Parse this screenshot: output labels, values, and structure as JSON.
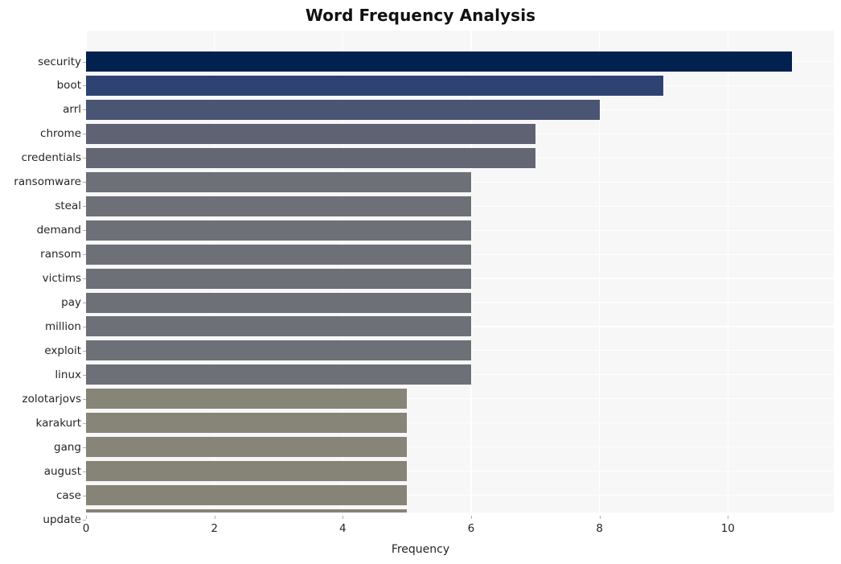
{
  "chart_data": {
    "type": "bar",
    "orientation": "horizontal",
    "title": "Word Frequency Analysis",
    "xlabel": "Frequency",
    "ylabel": "",
    "categories": [
      "security",
      "boot",
      "arrl",
      "chrome",
      "credentials",
      "ransomware",
      "steal",
      "demand",
      "ransom",
      "victims",
      "pay",
      "million",
      "exploit",
      "linux",
      "zolotarjovs",
      "karakurt",
      "gang",
      "august",
      "case",
      "update"
    ],
    "values": [
      11,
      9,
      8,
      7,
      7,
      6,
      6,
      6,
      6,
      6,
      6,
      6,
      6,
      6,
      5,
      5,
      5,
      5,
      5,
      5
    ],
    "bar_colors": [
      "#03214f",
      "#2e4371",
      "#4a5574",
      "#5e6272",
      "#646773",
      "#6e7077",
      "#6e7077",
      "#6e7077",
      "#6e7077",
      "#6e7077",
      "#6e7077",
      "#6e7077",
      "#6e7077",
      "#6e7077",
      "#878578",
      "#878578",
      "#878578",
      "#868477",
      "#868477",
      "#868477"
    ],
    "xlim": [
      0,
      11.65
    ],
    "xticks": [
      0,
      2,
      4,
      6,
      8,
      10
    ],
    "xtick_labels": [
      "0",
      "2",
      "4",
      "6",
      "8",
      "10"
    ],
    "grid": true,
    "grid_color": "#ffffff",
    "plot_background": "#f7f7f7",
    "figure_background": "#ffffff",
    "legend": null,
    "legend_position": "none"
  }
}
